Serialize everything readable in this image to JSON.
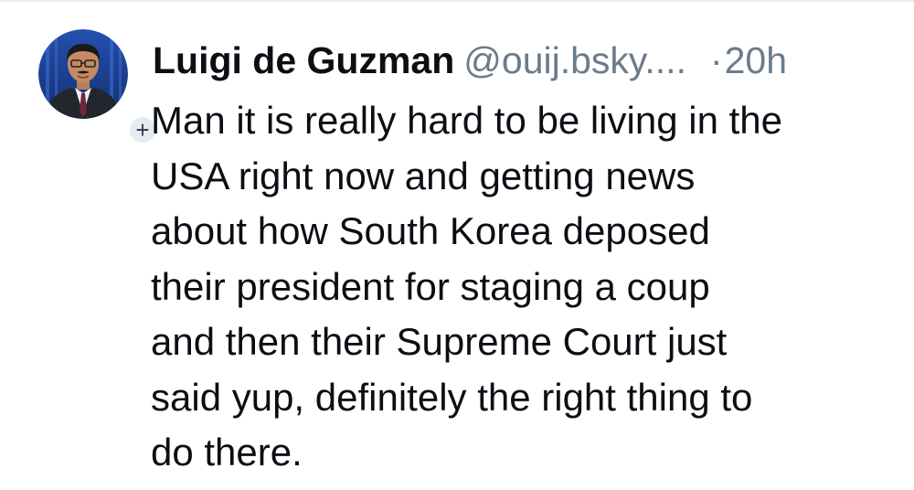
{
  "post": {
    "author": {
      "display_name": "Luigi de Guzman",
      "handle": "@ouij.bsky....",
      "avatar_icon": "author-avatar",
      "follow_badge": "+"
    },
    "timestamp_separator": "·",
    "timestamp": "20h",
    "text": "Man it is really hard to be living in the\nUSA right now and getting news\nabout how South Korea deposed\ntheir president for staging a coup\nand then their Supreme Court just\nsaid yup, definitely the right thing to\ndo there."
  },
  "colors": {
    "text_primary": "#0b0f14",
    "text_secondary": "#6b7b8c",
    "badge_bg": "#e6ebf0",
    "avatar_bg": "#1b3f8f"
  }
}
